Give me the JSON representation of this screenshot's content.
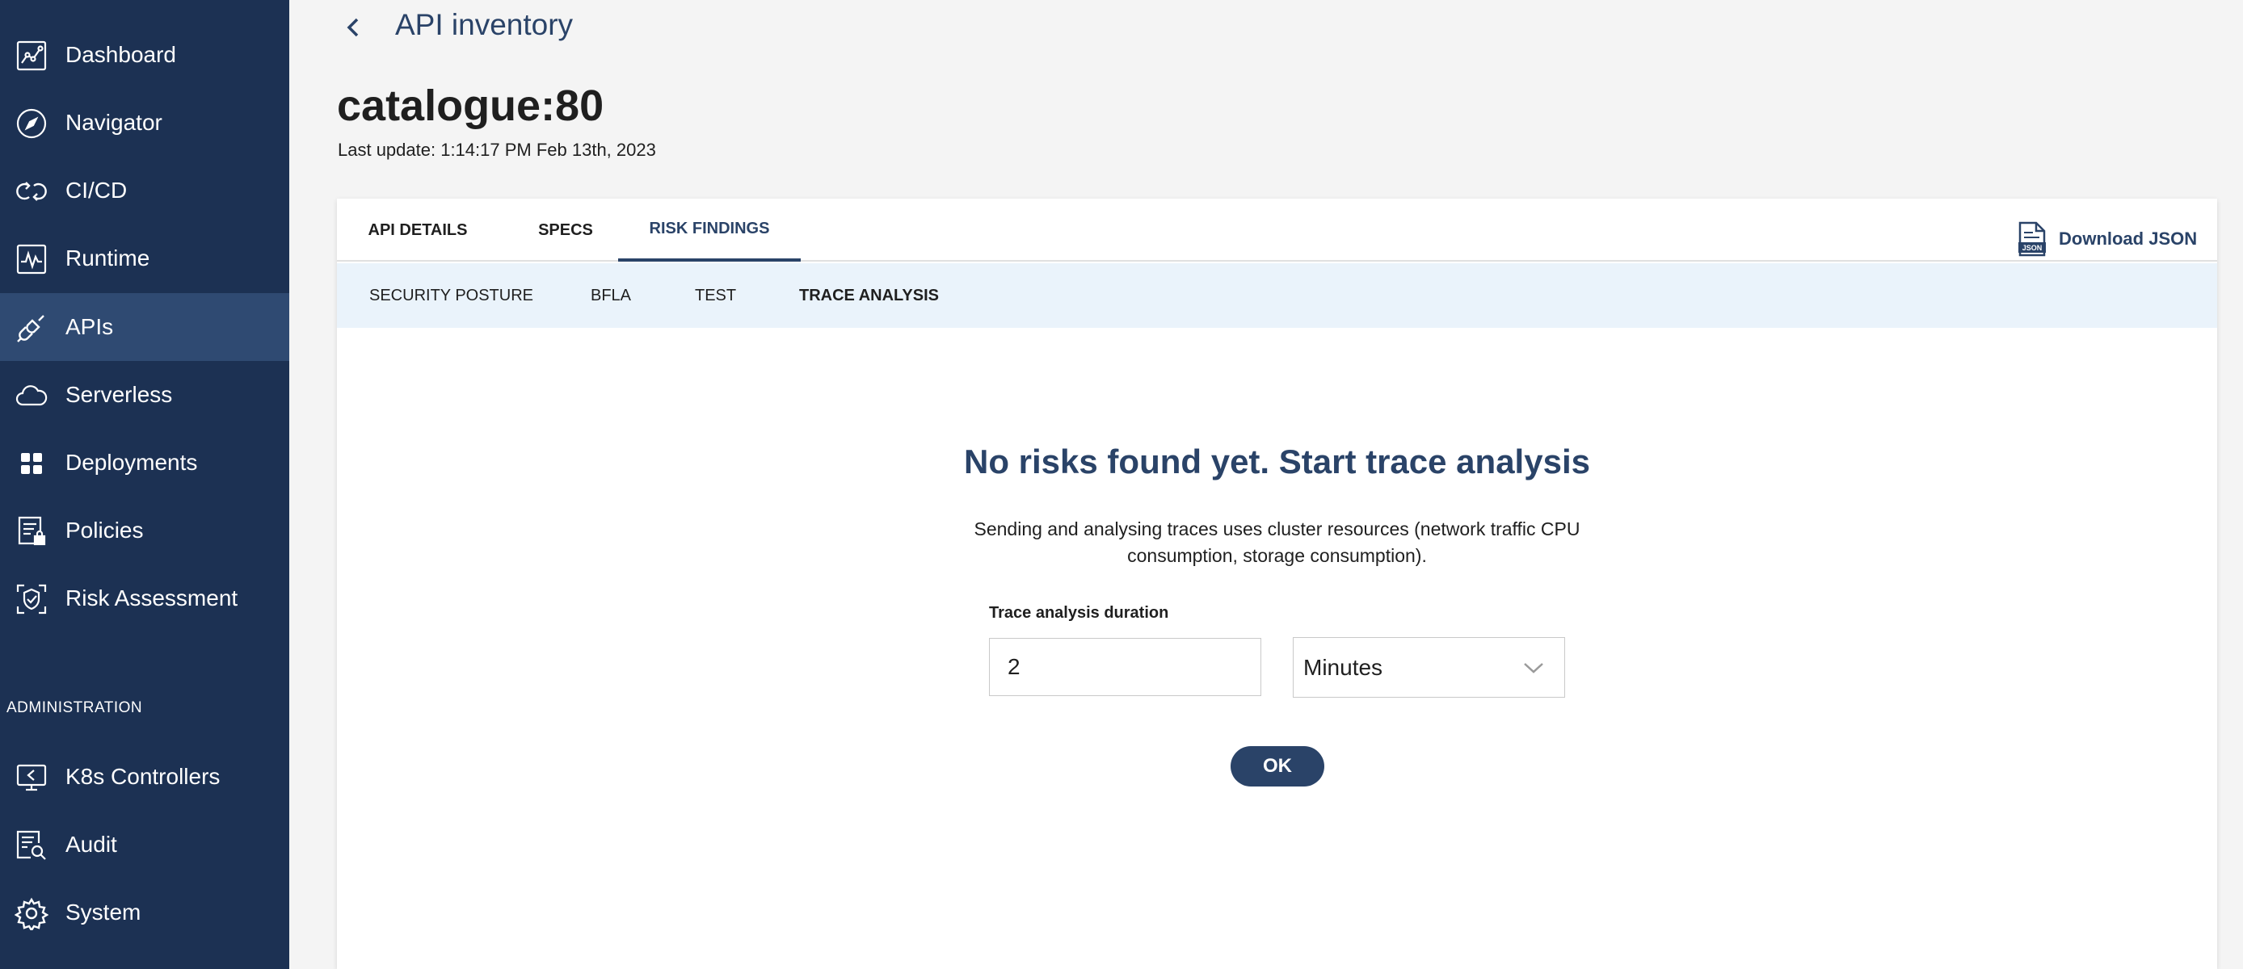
{
  "sidebar": {
    "items": [
      {
        "label": "Dashboard",
        "icon": "dashboard-icon"
      },
      {
        "label": "Navigator",
        "icon": "compass-icon"
      },
      {
        "label": "CI/CD",
        "icon": "cicd-icon"
      },
      {
        "label": "Runtime",
        "icon": "runtime-icon"
      },
      {
        "label": "APIs",
        "icon": "api-icon"
      },
      {
        "label": "Serverless",
        "icon": "cloud-icon"
      },
      {
        "label": "Deployments",
        "icon": "grid-icon"
      },
      {
        "label": "Policies",
        "icon": "policy-lock-icon"
      },
      {
        "label": "Risk Assessment",
        "icon": "shield-scan-icon"
      }
    ],
    "active": "APIs",
    "section_label": "ADMINISTRATION",
    "admin_items": [
      {
        "label": "K8s Controllers",
        "icon": "monitor-back-icon"
      },
      {
        "label": "Audit",
        "icon": "audit-search-icon"
      },
      {
        "label": "System",
        "icon": "gear-icon"
      }
    ]
  },
  "header": {
    "breadcrumb": "API inventory",
    "title": "catalogue:80",
    "last_update": "Last update: 1:14:17 PM Feb 13th, 2023"
  },
  "tabs": [
    {
      "label": "API DETAILS"
    },
    {
      "label": "SPECS"
    },
    {
      "label": "RISK FINDINGS"
    }
  ],
  "active_tab": "RISK FINDINGS",
  "download_label": "Download JSON",
  "subtabs": [
    {
      "label": "SECURITY POSTURE"
    },
    {
      "label": "BFLA"
    },
    {
      "label": "TEST"
    },
    {
      "label": "TRACE ANALYSIS"
    }
  ],
  "active_subtab": "TRACE ANALYSIS",
  "empty_state": {
    "title": "No risks found yet. Start trace analysis",
    "description": "Sending and analysing traces uses cluster resources (network traffic CPU consumption, storage consumption).",
    "field_label": "Trace analysis duration",
    "duration_value": "2",
    "unit_value": "Minutes",
    "ok_label": "OK"
  },
  "colors": {
    "sidebar_bg": "#1c3153",
    "sidebar_active": "#2f4a72",
    "accent": "#2a4368",
    "subtab_bg": "#eaf3fb"
  }
}
